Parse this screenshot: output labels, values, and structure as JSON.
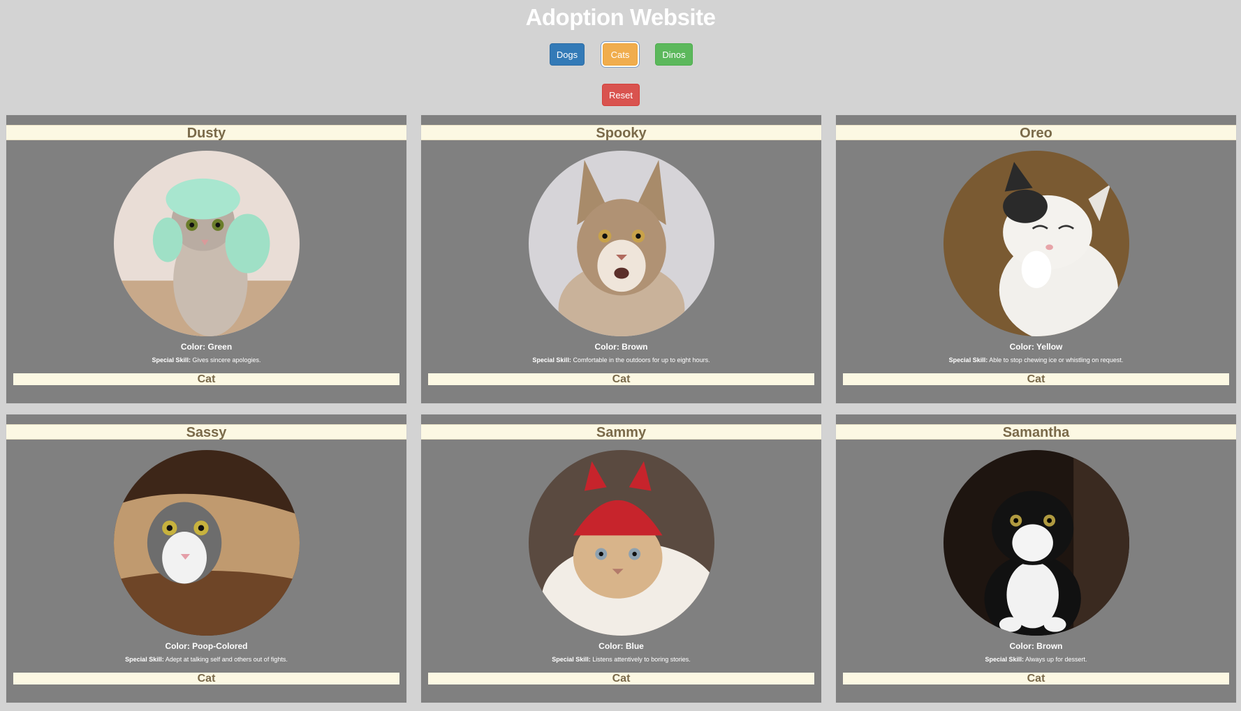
{
  "header": {
    "title": "Adoption Website"
  },
  "filters": {
    "dogs": "Dogs",
    "cats": "Cats",
    "dinos": "Dinos",
    "reset": "Reset"
  },
  "pets": [
    {
      "name": "Dusty",
      "color_label": "Color:",
      "color": "Green",
      "skill_label": "Special Skill:",
      "skill": "Gives sincere apologies.",
      "type": "Cat",
      "photo_icon": "cat-photo-icon"
    },
    {
      "name": "Spooky",
      "color_label": "Color:",
      "color": "Brown",
      "skill_label": "Special Skill:",
      "skill": "Comfortable in the outdoors for up to eight hours.",
      "type": "Cat",
      "photo_icon": "cat-photo-icon"
    },
    {
      "name": "Oreo",
      "color_label": "Color:",
      "color": "Yellow",
      "skill_label": "Special Skill:",
      "skill": "Able to stop chewing ice or whistling on request.",
      "type": "Cat",
      "photo_icon": "cat-photo-icon"
    },
    {
      "name": "Sassy",
      "color_label": "Color:",
      "color": "Poop-Colored",
      "skill_label": "Special Skill:",
      "skill": "Adept at talking self and others out of fights.",
      "type": "Cat",
      "photo_icon": "cat-photo-icon"
    },
    {
      "name": "Sammy",
      "color_label": "Color:",
      "color": "Blue",
      "skill_label": "Special Skill:",
      "skill": "Listens attentively to boring stories.",
      "type": "Cat",
      "photo_icon": "cat-photo-icon"
    },
    {
      "name": "Samantha",
      "color_label": "Color:",
      "color": "Brown",
      "skill_label": "Special Skill:",
      "skill": "Always up for dessert.",
      "type": "Cat",
      "photo_icon": "cat-photo-icon"
    }
  ],
  "colors": {
    "background": "#d3d3d3",
    "card": "#808080",
    "label_band": "#fcf8e3",
    "dogs_button": "#337ab7",
    "cats_button": "#f0ad4e",
    "dinos_button": "#5cb85c",
    "reset_button": "#d9534f"
  }
}
